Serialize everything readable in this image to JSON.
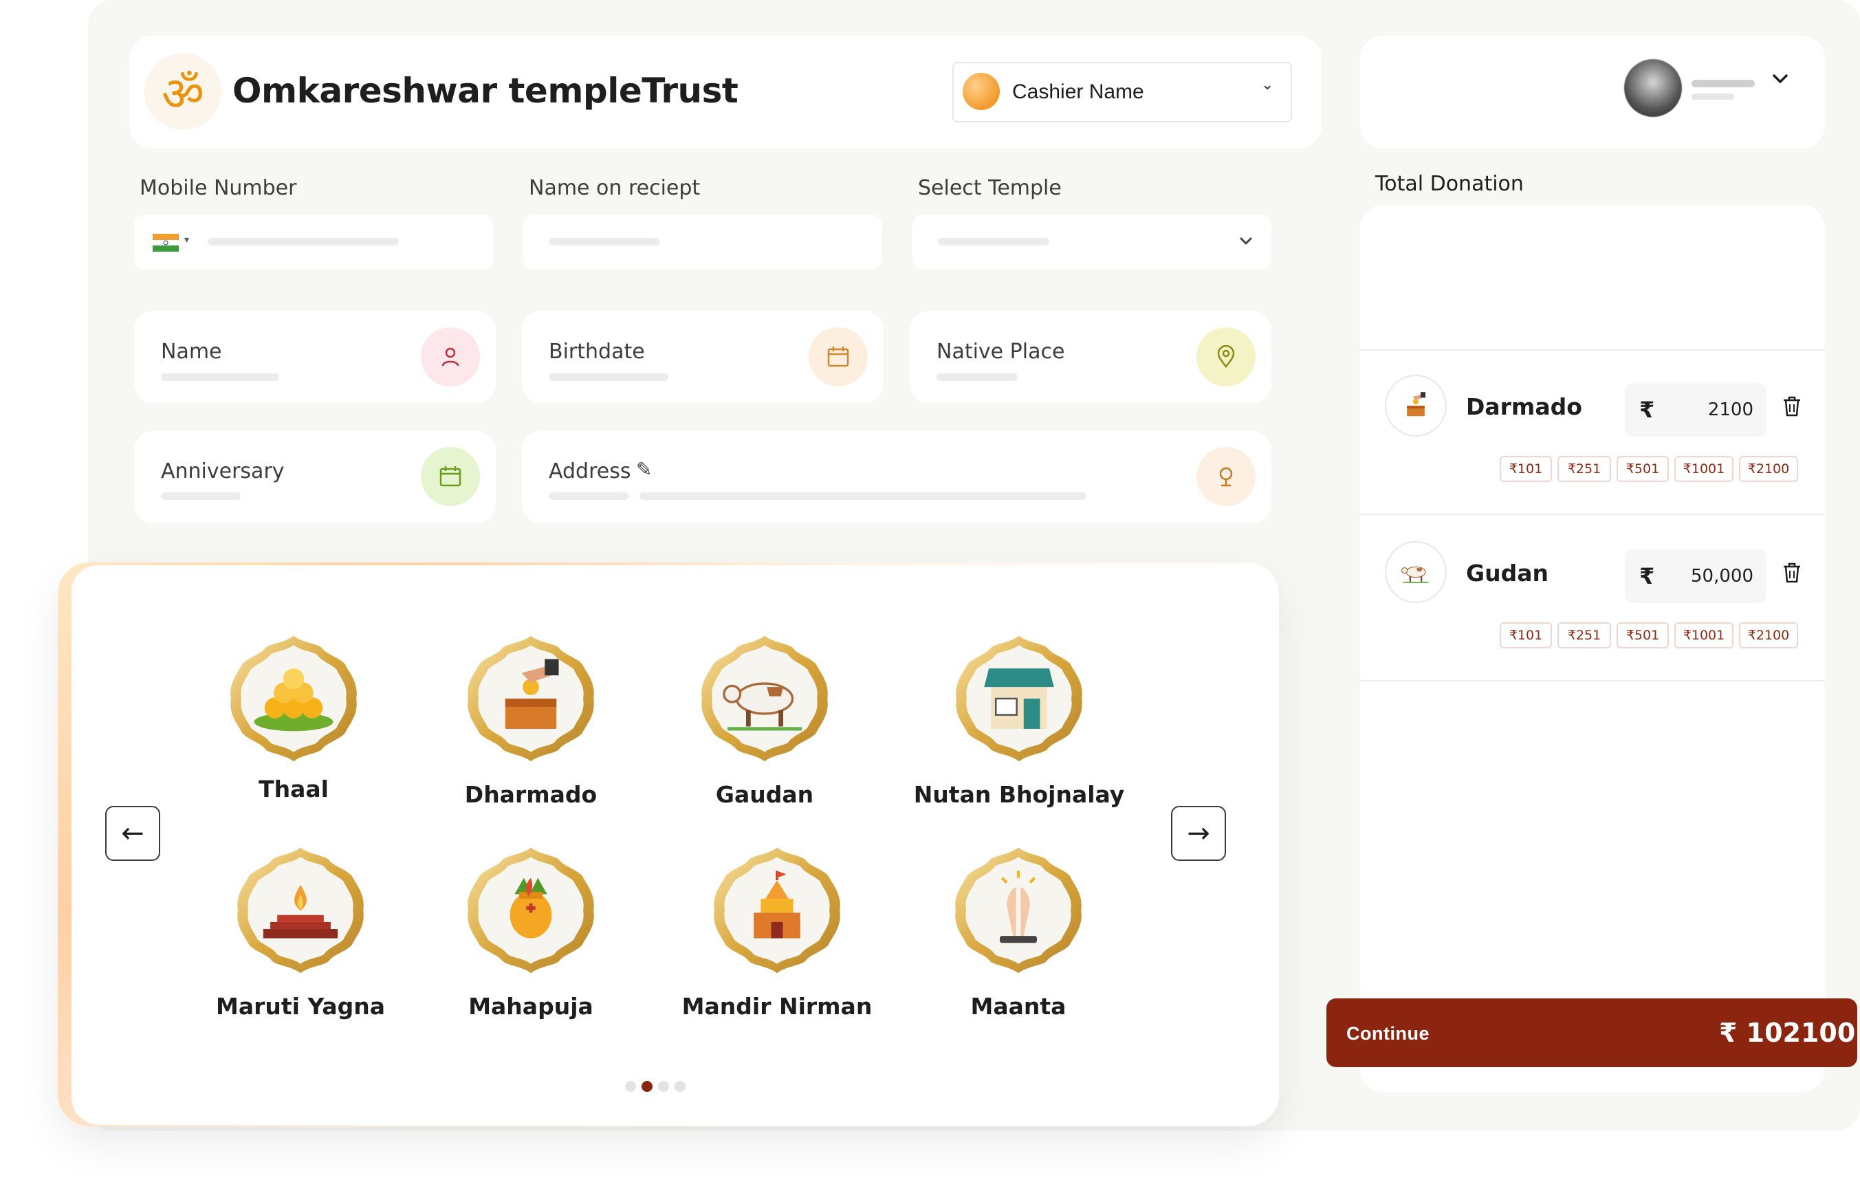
{
  "header": {
    "logo_symbol": "ॐ",
    "title": "Omkareshwar templeTrust",
    "cashier_label": "Cashier Name"
  },
  "form": {
    "mobile_label": "Mobile Number",
    "receipt_label": "Name on reciept",
    "temple_label": "Select Temple",
    "name_label": "Name",
    "birthdate_label": "Birthdate",
    "native_label": "Native Place",
    "anniversary_label": "Anniversary",
    "address_label": "Address"
  },
  "categories": [
    {
      "label": "Thaal",
      "icon": "sweets-plate-icon"
    },
    {
      "label": "Dharmado",
      "icon": "donation-box-icon"
    },
    {
      "label": "Gaudan",
      "icon": "cow-icon"
    },
    {
      "label": "Nutan Bhojnalay",
      "icon": "shop-icon"
    },
    {
      "label": "Maruti Yagna",
      "icon": "fire-altar-icon"
    },
    {
      "label": "Mahapuja",
      "icon": "kalash-icon"
    },
    {
      "label": "Mandir Nirman",
      "icon": "temple-icon"
    },
    {
      "label": "Maanta",
      "icon": "praying-hands-icon"
    }
  ],
  "carousel": {
    "page_count": 4,
    "active_page": 1
  },
  "summary": {
    "title": "Total Donation",
    "currency_symbol": "₹",
    "items": [
      {
        "name": "Darmado",
        "amount": "2100",
        "icon": "donation-box-icon"
      },
      {
        "name": "Gudan",
        "amount": "50,000",
        "icon": "cow-icon"
      }
    ],
    "quick_amounts": [
      "₹101",
      "₹251",
      "₹501",
      "₹1001",
      "₹2100"
    ]
  },
  "footer": {
    "continue_label": "Continue",
    "total": "₹ 102100"
  },
  "colors": {
    "accent": "#8b250f",
    "background": "#f7f7f3",
    "om": "#e9930f"
  }
}
